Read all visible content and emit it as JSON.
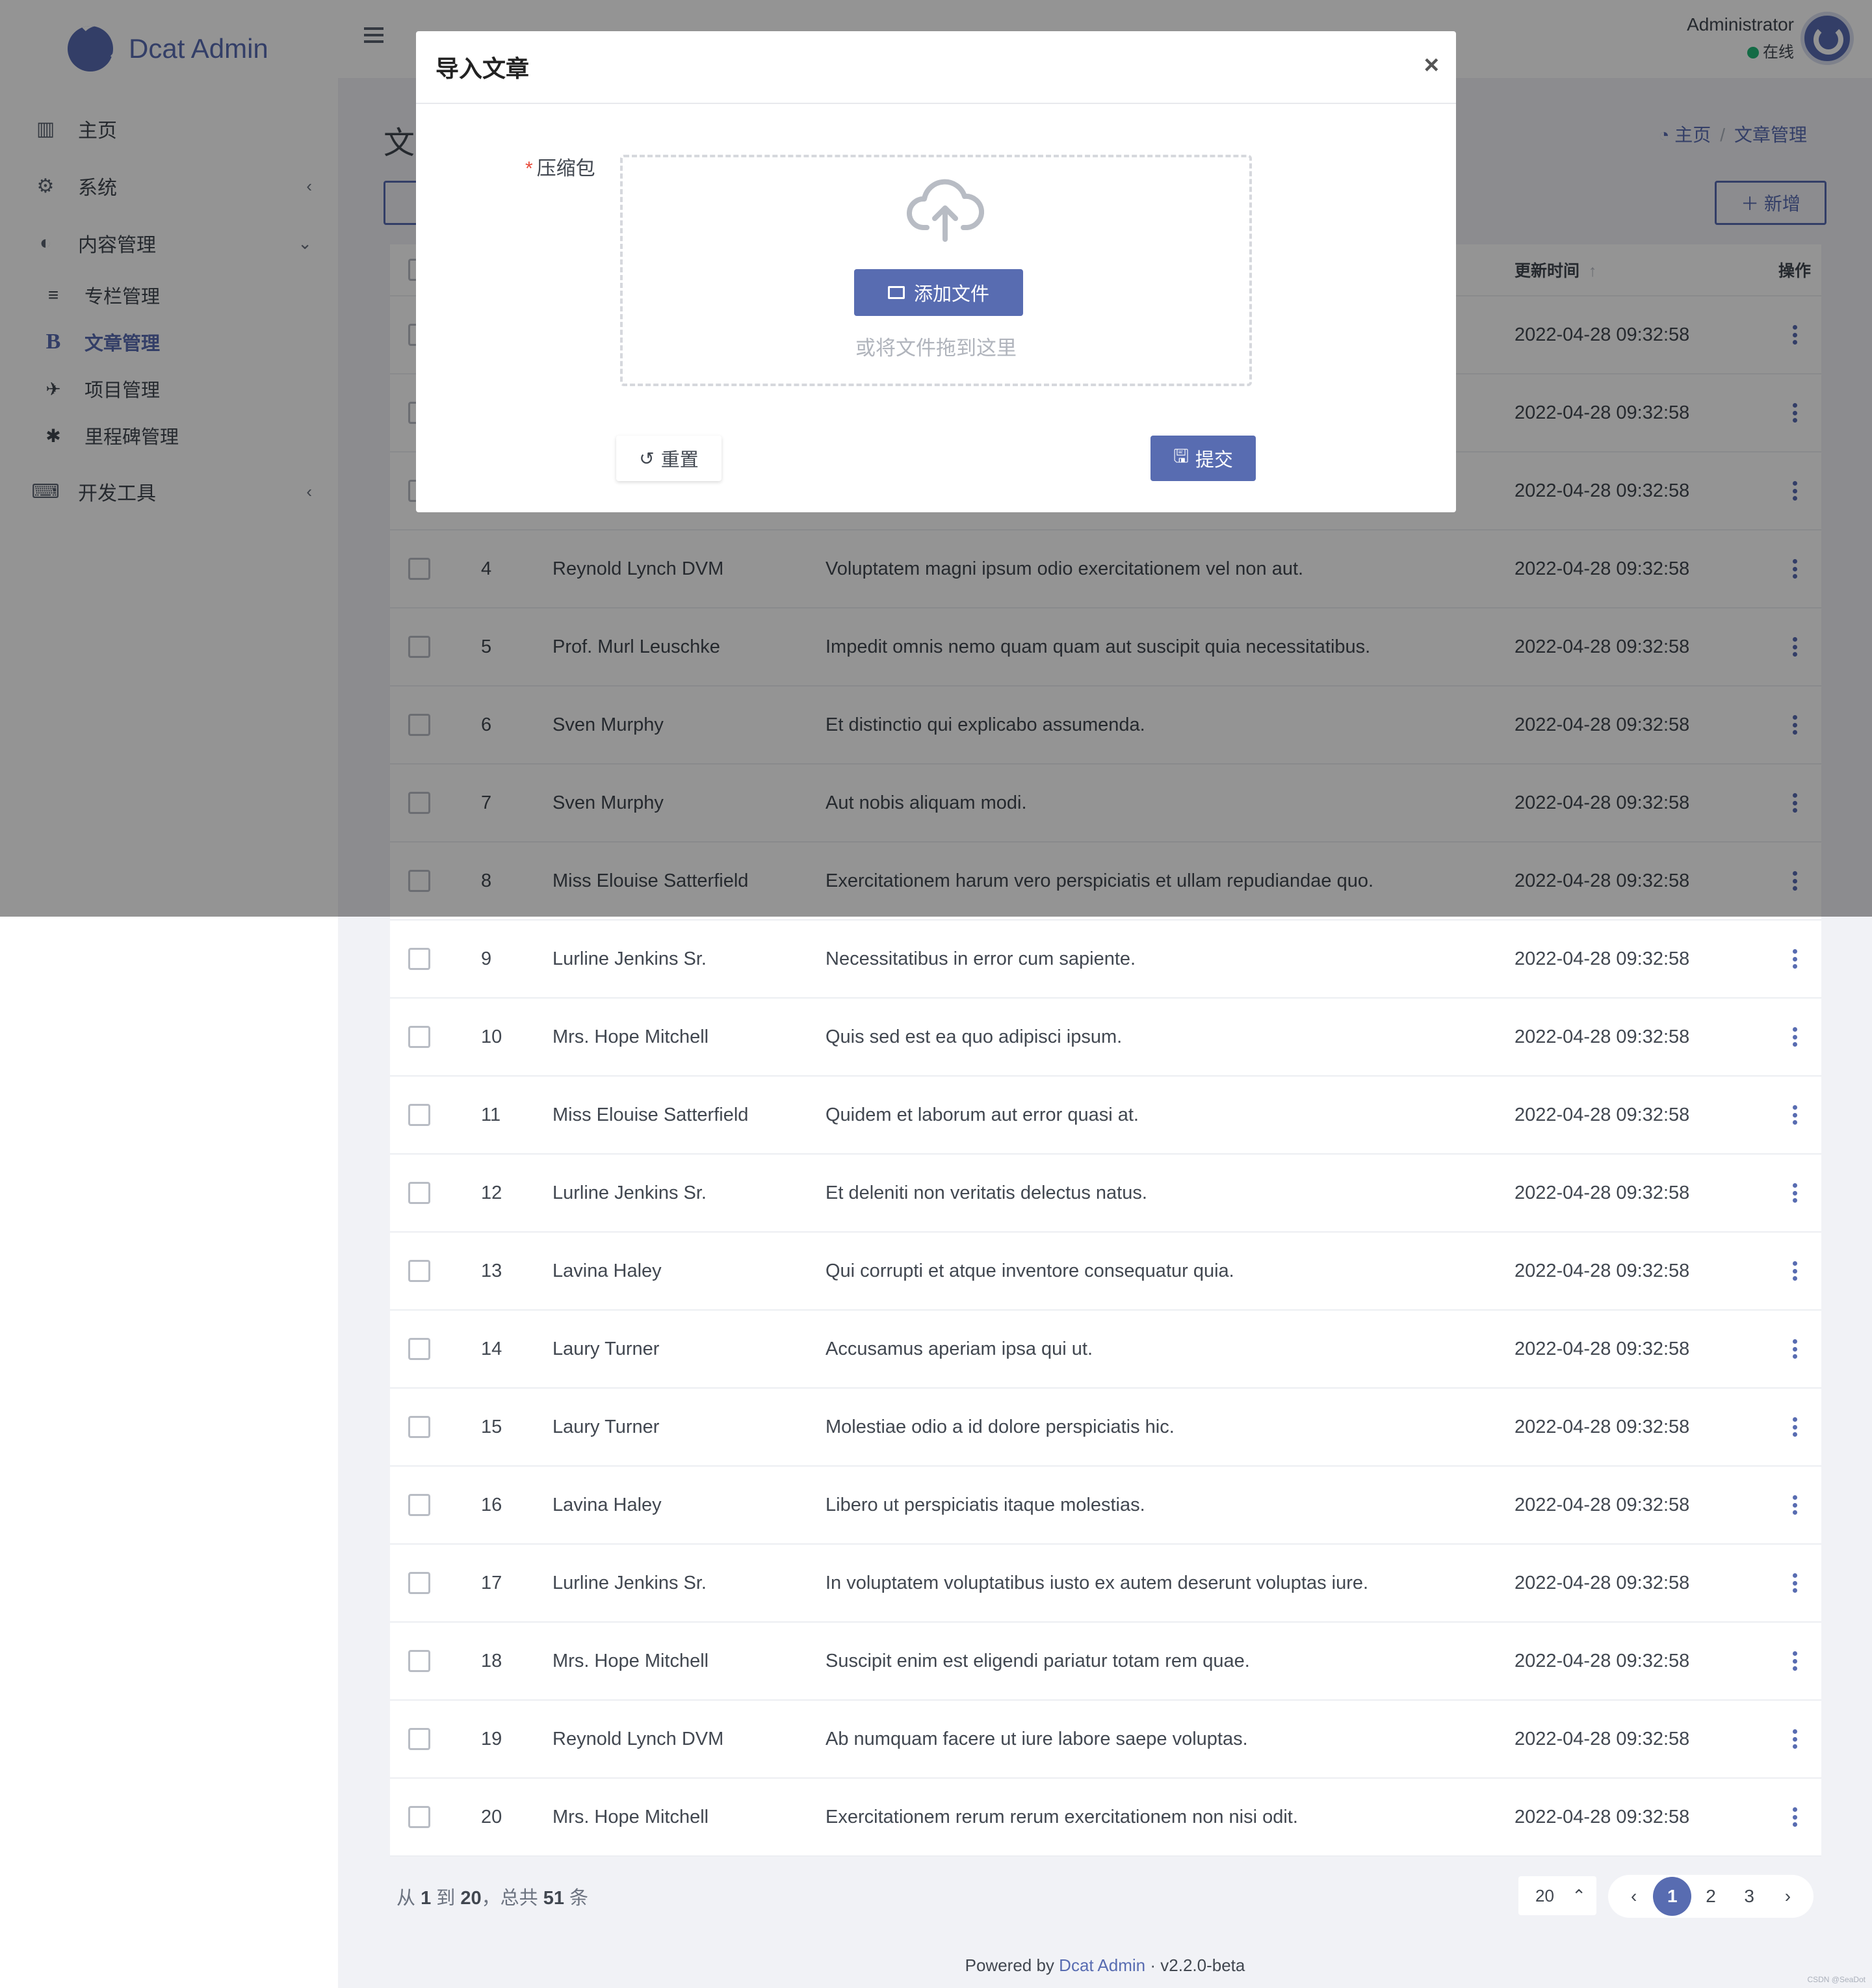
{
  "brand": {
    "name": "Dcat Admin"
  },
  "sidebar": {
    "items": [
      {
        "icon": "bar-chart-icon",
        "glyph": "▥",
        "label": "主页"
      },
      {
        "icon": "gear-icon",
        "glyph": "⚙",
        "label": "系统",
        "chevron": "‹"
      },
      {
        "icon": "contrast-icon",
        "glyph": "◐",
        "label": "内容管理",
        "chevron": "⌄"
      }
    ],
    "sub_items": [
      {
        "icon": "list-icon",
        "glyph": "≡",
        "label": "专栏管理"
      },
      {
        "icon": "bold-b-icon",
        "glyph": "B",
        "label": "文章管理"
      },
      {
        "icon": "project-icon",
        "glyph": "✈",
        "label": "项目管理"
      },
      {
        "icon": "asterisk-icon",
        "glyph": "✱",
        "label": "里程碑管理"
      }
    ],
    "dev_tools": {
      "icon": "keyboard-icon",
      "glyph": "⌨",
      "label": "开发工具",
      "chevron": "‹"
    }
  },
  "header": {
    "user_name": "Administrator",
    "user_status": "在线"
  },
  "page": {
    "title": "文",
    "breadcrumb": {
      "home": "主页",
      "current": "文章管理",
      "sep": "/"
    },
    "new_button": "＋ 新增"
  },
  "table": {
    "headers": {
      "time": "更新时间",
      "time_sort": "↑",
      "actions": "操作"
    },
    "rows": [
      {
        "id": "",
        "author": "",
        "title": "",
        "time": "2022-04-28 09:32:58"
      },
      {
        "id": "",
        "author": "",
        "title": "",
        "time": "2022-04-28 09:32:58"
      },
      {
        "id": "",
        "author": "",
        "title": "",
        "time": "2022-04-28 09:32:58"
      },
      {
        "id": "4",
        "author": "Reynold Lynch DVM",
        "title": "Voluptatem magni ipsum odio exercitationem vel non aut.",
        "time": "2022-04-28 09:32:58"
      },
      {
        "id": "5",
        "author": "Prof. Murl Leuschke",
        "title": "Impedit omnis nemo quam quam aut suscipit quia necessitatibus.",
        "time": "2022-04-28 09:32:58"
      },
      {
        "id": "6",
        "author": "Sven Murphy",
        "title": "Et distinctio qui explicabo assumenda.",
        "time": "2022-04-28 09:32:58"
      },
      {
        "id": "7",
        "author": "Sven Murphy",
        "title": "Aut nobis aliquam modi.",
        "time": "2022-04-28 09:32:58"
      },
      {
        "id": "8",
        "author": "Miss Elouise Satterfield",
        "title": "Exercitationem harum vero perspiciatis et ullam repudiandae quo.",
        "time": "2022-04-28 09:32:58"
      },
      {
        "id": "9",
        "author": "Lurline Jenkins Sr.",
        "title": "Necessitatibus in error cum sapiente.",
        "time": "2022-04-28 09:32:58"
      },
      {
        "id": "10",
        "author": "Mrs. Hope Mitchell",
        "title": "Quis sed est ea quo adipisci ipsum.",
        "time": "2022-04-28 09:32:58"
      },
      {
        "id": "11",
        "author": "Miss Elouise Satterfield",
        "title": "Quidem et laborum aut error quasi at.",
        "time": "2022-04-28 09:32:58"
      },
      {
        "id": "12",
        "author": "Lurline Jenkins Sr.",
        "title": "Et deleniti non veritatis delectus natus.",
        "time": "2022-04-28 09:32:58"
      },
      {
        "id": "13",
        "author": "Lavina Haley",
        "title": "Qui corrupti et atque inventore consequatur quia.",
        "time": "2022-04-28 09:32:58"
      },
      {
        "id": "14",
        "author": "Laury Turner",
        "title": "Accusamus aperiam ipsa qui ut.",
        "time": "2022-04-28 09:32:58"
      },
      {
        "id": "15",
        "author": "Laury Turner",
        "title": "Molestiae odio a id dolore perspiciatis hic.",
        "time": "2022-04-28 09:32:58"
      },
      {
        "id": "16",
        "author": "Lavina Haley",
        "title": "Libero ut perspiciatis itaque molestias.",
        "time": "2022-04-28 09:32:58"
      },
      {
        "id": "17",
        "author": "Lurline Jenkins Sr.",
        "title": "In voluptatem voluptatibus iusto ex autem deserunt voluptas iure.",
        "time": "2022-04-28 09:32:58"
      },
      {
        "id": "18",
        "author": "Mrs. Hope Mitchell",
        "title": "Suscipit enim est eligendi pariatur totam rem quae.",
        "time": "2022-04-28 09:32:58"
      },
      {
        "id": "19",
        "author": "Reynold Lynch DVM",
        "title": "Ab numquam facere ut iure labore saepe voluptas.",
        "time": "2022-04-28 09:32:58"
      },
      {
        "id": "20",
        "author": "Mrs. Hope Mitchell",
        "title": "Exercitationem rerum rerum exercitationem non nisi odit.",
        "time": "2022-04-28 09:32:58"
      }
    ]
  },
  "pagination": {
    "summary_prefix": "从",
    "from": "1",
    "to_word": "到",
    "to": "20",
    "total_prefix": "，总共",
    "total": "51",
    "unit": "条",
    "per_page": "20",
    "per_page_arrow": "⌃",
    "prev": "‹",
    "next": "›",
    "pages": [
      "1",
      "2",
      "3"
    ],
    "current_page": "1"
  },
  "footer": {
    "powered_by": "Powered by",
    "link": "Dcat Admin",
    "dot": "·",
    "version": "v2.2.0-beta",
    "corner": "CSDN @SeaDot"
  },
  "modal": {
    "title": "导入文章",
    "close": "×",
    "field_label": "压缩包",
    "required_mark": "*",
    "add_file": "添加文件",
    "drop_hint": "或将文件拖到这里",
    "reset": "重置",
    "reset_icon": "↺",
    "submit": "提交",
    "submit_icon": "🖫"
  },
  "colors": {
    "accent": "#586cb1",
    "online": "#21b978",
    "required": "#e74c3c",
    "overlay": "rgba(0,0,0,0.42)"
  }
}
